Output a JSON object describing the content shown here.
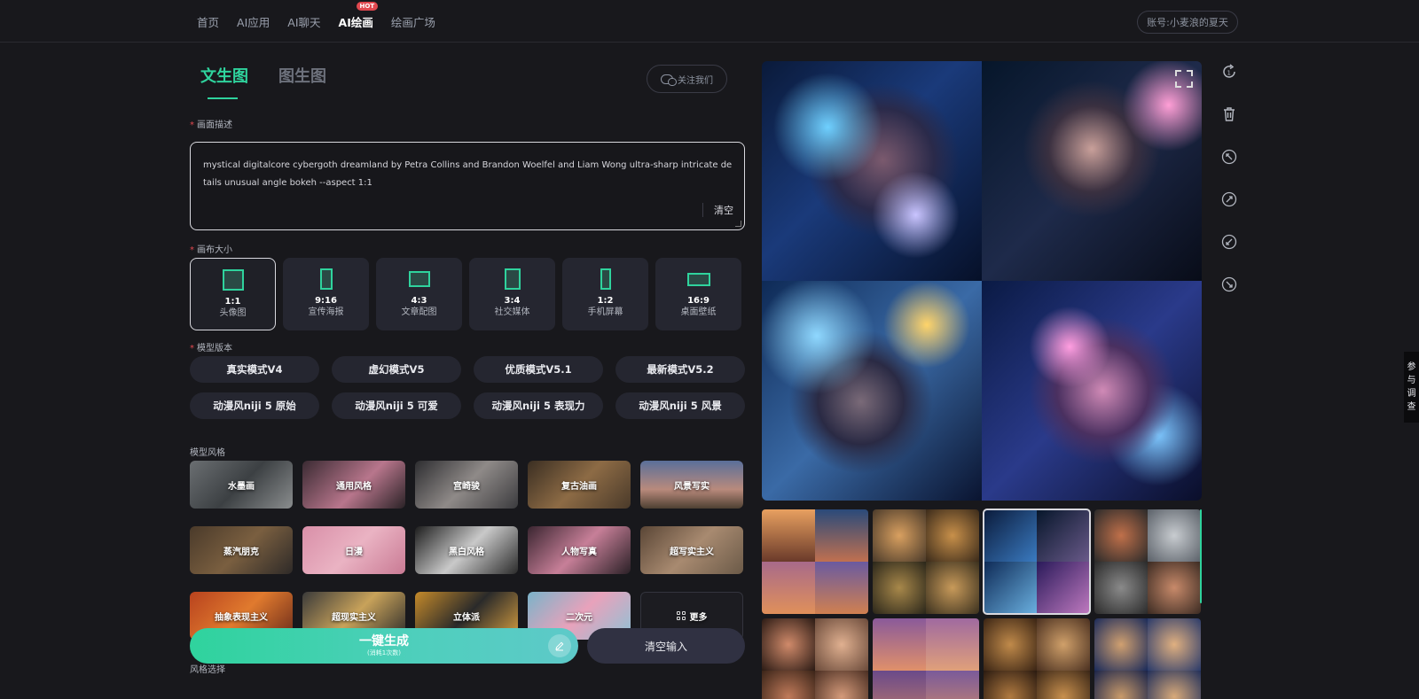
{
  "nav": {
    "items": [
      "首页",
      "AI应用",
      "AI聊天",
      "AI绘画",
      "绘画广场"
    ],
    "active_index": 3,
    "hot_badge": "HOT",
    "account": "账号:小麦浪的夏天"
  },
  "tabs": [
    "文生图",
    "图生图"
  ],
  "follow_label": "关注我们",
  "description": {
    "label": "画面描述",
    "text": "mystical digitalcore cybergoth dreamland by Petra Collins and Brandon Woelfel and Liam Wong ultra-sharp intricate details unusual angle bokeh --aspect 1:1",
    "clear": "清空"
  },
  "canvas_size": {
    "label": "画布大小",
    "options": [
      {
        "ratio": "1:1",
        "use": "头像图"
      },
      {
        "ratio": "9:16",
        "use": "宣传海报"
      },
      {
        "ratio": "4:3",
        "use": "文章配图"
      },
      {
        "ratio": "3:4",
        "use": "社交媒体"
      },
      {
        "ratio": "1:2",
        "use": "手机屏幕"
      },
      {
        "ratio": "16:9",
        "use": "桌面壁纸"
      }
    ]
  },
  "model_version": {
    "label": "模型版本",
    "options": [
      "真实模式V4",
      "虚幻模式V5",
      "优质模式V5.1",
      "最新模式V5.2",
      "动漫风niji 5 原始",
      "动漫风niji 5 可爱",
      "动漫风niji 5 表现力",
      "动漫风niji 5 风景"
    ]
  },
  "model_style": {
    "label": "模型风格",
    "options": [
      "水墨画",
      "通用风格",
      "宫崎骏",
      "复古油画",
      "风景写实",
      "蒸汽朋克",
      "日漫",
      "黑白风格",
      "人物写真",
      "超写实主义",
      "抽象表现主义",
      "超现实主义",
      "立体派",
      "二次元"
    ],
    "more": "更多"
  },
  "generate": {
    "label": "一键生成",
    "sub": "(消耗1次数)"
  },
  "clear_input": "清空输入",
  "style_select_label": "风格选择",
  "side_tab": "参与调查"
}
